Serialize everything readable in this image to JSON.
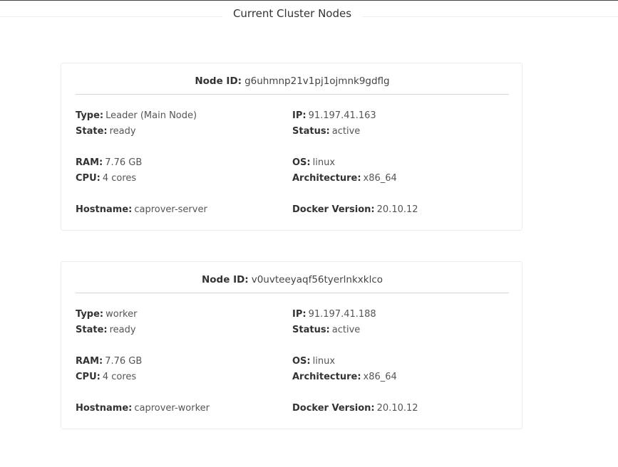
{
  "section": {
    "title": "Current Cluster Nodes"
  },
  "nodes": [
    {
      "node_id_label": "Node ID:",
      "node_id": "g6uhmnp21v1pj1ojmnk9gdflg",
      "type_label": "Type:",
      "type": "Leader (Main Node)",
      "ip_label": "IP:",
      "ip": "91.197.41.163",
      "state_label": "State:",
      "state": "ready",
      "status_label": "Status:",
      "status": "active",
      "ram_label": "RAM:",
      "ram": "7.76 GB",
      "os_label": "OS:",
      "os": "linux",
      "cpu_label": "CPU:",
      "cpu": "4 cores",
      "arch_label": "Architecture:",
      "arch": "x86_64",
      "hostname_label": "Hostname:",
      "hostname": "caprover-server",
      "docker_label": "Docker Version:",
      "docker": "20.10.12"
    },
    {
      "node_id_label": "Node ID:",
      "node_id": "v0uvteeyaqf56tyerlnkxklco",
      "type_label": "Type:",
      "type": "worker",
      "ip_label": "IP:",
      "ip": "91.197.41.188",
      "state_label": "State:",
      "state": "ready",
      "status_label": "Status:",
      "status": "active",
      "ram_label": "RAM:",
      "ram": "7.76 GB",
      "os_label": "OS:",
      "os": "linux",
      "cpu_label": "CPU:",
      "cpu": "4 cores",
      "arch_label": "Architecture:",
      "arch": "x86_64",
      "hostname_label": "Hostname:",
      "hostname": "caprover-worker",
      "docker_label": "Docker Version:",
      "docker": "20.10.12"
    }
  ]
}
